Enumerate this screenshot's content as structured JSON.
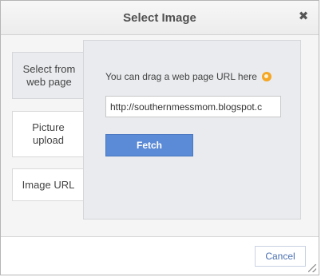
{
  "dialog": {
    "title": "Select Image",
    "close_icon": "close-icon"
  },
  "tabs": [
    {
      "label": "Select from web page",
      "active": true
    },
    {
      "label": "Picture upload",
      "active": false
    },
    {
      "label": "Image URL",
      "active": false
    }
  ],
  "panel": {
    "hint": "You can drag a web page URL here",
    "hint_icon": "tip-icon",
    "url_value": "http://southernmessmom.blogspot.c",
    "fetch_label": "Fetch"
  },
  "footer": {
    "cancel_label": "Cancel"
  },
  "colors": {
    "accent": "#5b8ad6",
    "active_tab_bg": "#e9ebee"
  }
}
